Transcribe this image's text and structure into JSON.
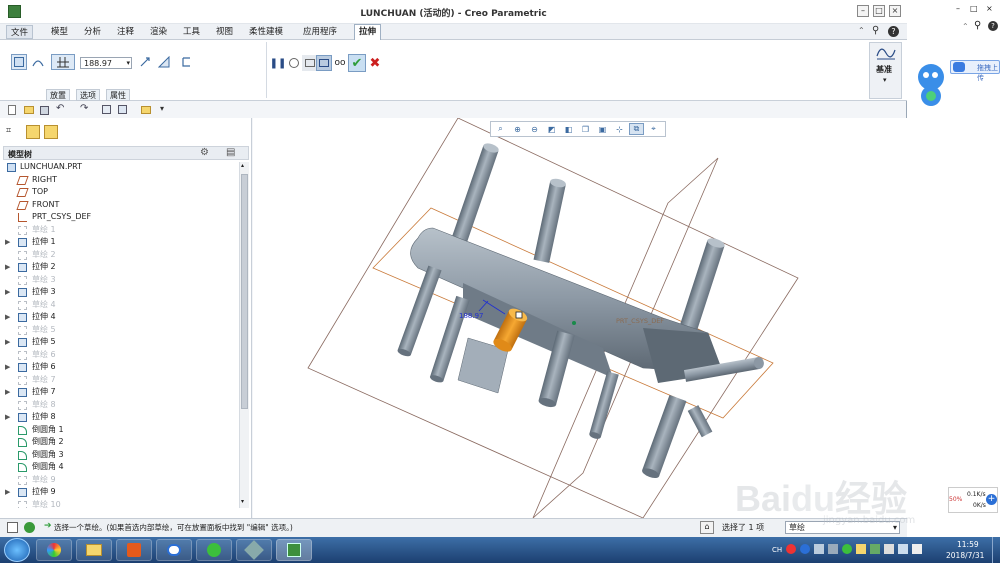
{
  "window": {
    "title": "LUNCHUAN (活动的) - Creo Parametric"
  },
  "menu_tabs": [
    {
      "label": "文件"
    },
    {
      "label": "模型"
    },
    {
      "label": "分析"
    },
    {
      "label": "注释"
    },
    {
      "label": "渲染"
    },
    {
      "label": "工具"
    },
    {
      "label": "视图"
    },
    {
      "label": "柔性建模"
    },
    {
      "label": "应用程序"
    },
    {
      "label": "拉伸"
    }
  ],
  "ribbon": {
    "depth_value": "188.97",
    "subtabs": [
      "放置",
      "选项",
      "属性"
    ],
    "datum_label": "基准"
  },
  "model_tree": {
    "header": "模型树",
    "root": "LUNCHUAN.PRT",
    "items": [
      {
        "label": "RIGHT",
        "type": "plane",
        "expand": false,
        "dim": false
      },
      {
        "label": "TOP",
        "type": "plane",
        "expand": false,
        "dim": false
      },
      {
        "label": "FRONT",
        "type": "plane",
        "expand": false,
        "dim": false
      },
      {
        "label": "PRT_CSYS_DEF",
        "type": "csys",
        "expand": false,
        "dim": false
      },
      {
        "label": "草绘 1",
        "type": "sketch",
        "expand": false,
        "dim": true
      },
      {
        "label": "拉伸 1",
        "type": "extrude",
        "expand": true,
        "dim": false
      },
      {
        "label": "草绘 2",
        "type": "sketch",
        "expand": false,
        "dim": true
      },
      {
        "label": "拉伸 2",
        "type": "extrude",
        "expand": true,
        "dim": false
      },
      {
        "label": "草绘 3",
        "type": "sketch",
        "expand": false,
        "dim": true
      },
      {
        "label": "拉伸 3",
        "type": "extrude",
        "expand": true,
        "dim": false
      },
      {
        "label": "草绘 4",
        "type": "sketch",
        "expand": false,
        "dim": true
      },
      {
        "label": "拉伸 4",
        "type": "extrude",
        "expand": true,
        "dim": false
      },
      {
        "label": "草绘 5",
        "type": "sketch",
        "expand": false,
        "dim": true
      },
      {
        "label": "拉伸 5",
        "type": "extrude",
        "expand": true,
        "dim": false
      },
      {
        "label": "草绘 6",
        "type": "sketch",
        "expand": false,
        "dim": true
      },
      {
        "label": "拉伸 6",
        "type": "extrude",
        "expand": true,
        "dim": false
      },
      {
        "label": "草绘 7",
        "type": "sketch",
        "expand": false,
        "dim": true
      },
      {
        "label": "拉伸 7",
        "type": "extrude",
        "expand": true,
        "dim": false
      },
      {
        "label": "草绘 8",
        "type": "sketch",
        "expand": false,
        "dim": true
      },
      {
        "label": "拉伸 8",
        "type": "extrude",
        "expand": true,
        "dim": false
      },
      {
        "label": "倒圆角 1",
        "type": "round",
        "expand": false,
        "dim": false
      },
      {
        "label": "倒圆角 2",
        "type": "round",
        "expand": false,
        "dim": false
      },
      {
        "label": "倒圆角 3",
        "type": "round",
        "expand": false,
        "dim": false
      },
      {
        "label": "倒圆角 4",
        "type": "round",
        "expand": false,
        "dim": false
      },
      {
        "label": "草绘 9",
        "type": "sketch",
        "expand": false,
        "dim": true
      },
      {
        "label": "拉伸 9",
        "type": "extrude",
        "expand": true,
        "dim": false
      },
      {
        "label": "草绘 10",
        "type": "sketch",
        "expand": false,
        "dim": true
      }
    ]
  },
  "viewport": {
    "dimension_label": "188.97",
    "csys_label": "PRT_CSYS_DEF"
  },
  "statusbar": {
    "message": "选择一个草绘。(如果首选内部草绘，可在放置面板中找到 \"编辑\" 选项。)",
    "selected": "选择了 1 项",
    "filter": "草绘"
  },
  "right_pane": {
    "upload_label": "拖拽上传",
    "speed_up": "0.1K/s",
    "speed_down": "0K/s",
    "speed_pct": "50%"
  },
  "taskbar": {
    "time": "11:59",
    "date": "2018/7/31",
    "lang": "CH"
  },
  "watermark": {
    "url": "jingyan.baidu.com"
  },
  "colors": {
    "accent": "#3b6aa0",
    "part_gray": "#8c98a4",
    "highlight_orange": "#f0a020",
    "confirm_green": "#2f9d3a",
    "cancel_red": "#cc1f1f"
  }
}
